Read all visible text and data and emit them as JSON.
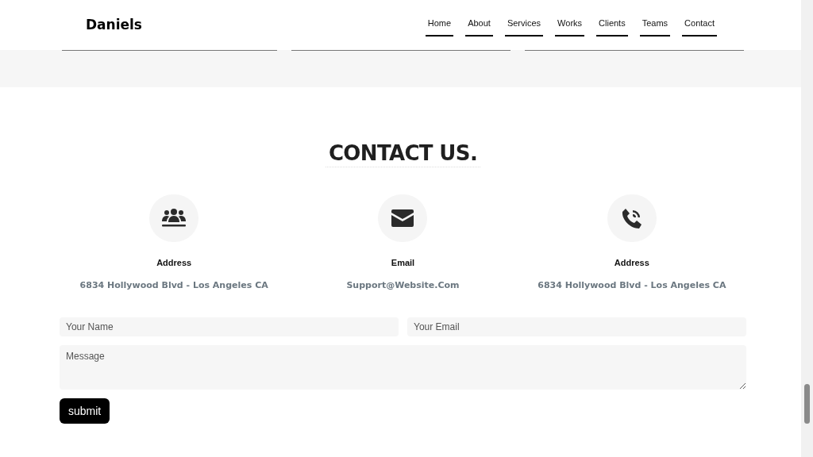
{
  "brand": "Daniels",
  "nav": [
    {
      "label": "Home"
    },
    {
      "label": "About"
    },
    {
      "label": "Services"
    },
    {
      "label": "Works"
    },
    {
      "label": "Clients"
    },
    {
      "label": "Teams"
    },
    {
      "label": "Contact"
    }
  ],
  "contact": {
    "title": "CONTACT US.",
    "items": [
      {
        "kind": "people",
        "label": "Address",
        "value": "6834 Hollywood Blvd - Los Angeles CA"
      },
      {
        "kind": "mail",
        "label": "Email",
        "value": "Support@Website.Com"
      },
      {
        "kind": "phone",
        "label": "Address",
        "value": "6834 Hollywood Blvd - Los Angeles CA"
      }
    ],
    "form": {
      "name_placeholder": "Your Name",
      "email_placeholder": "Your Email",
      "message_placeholder": "Message",
      "submit": "submit"
    }
  }
}
